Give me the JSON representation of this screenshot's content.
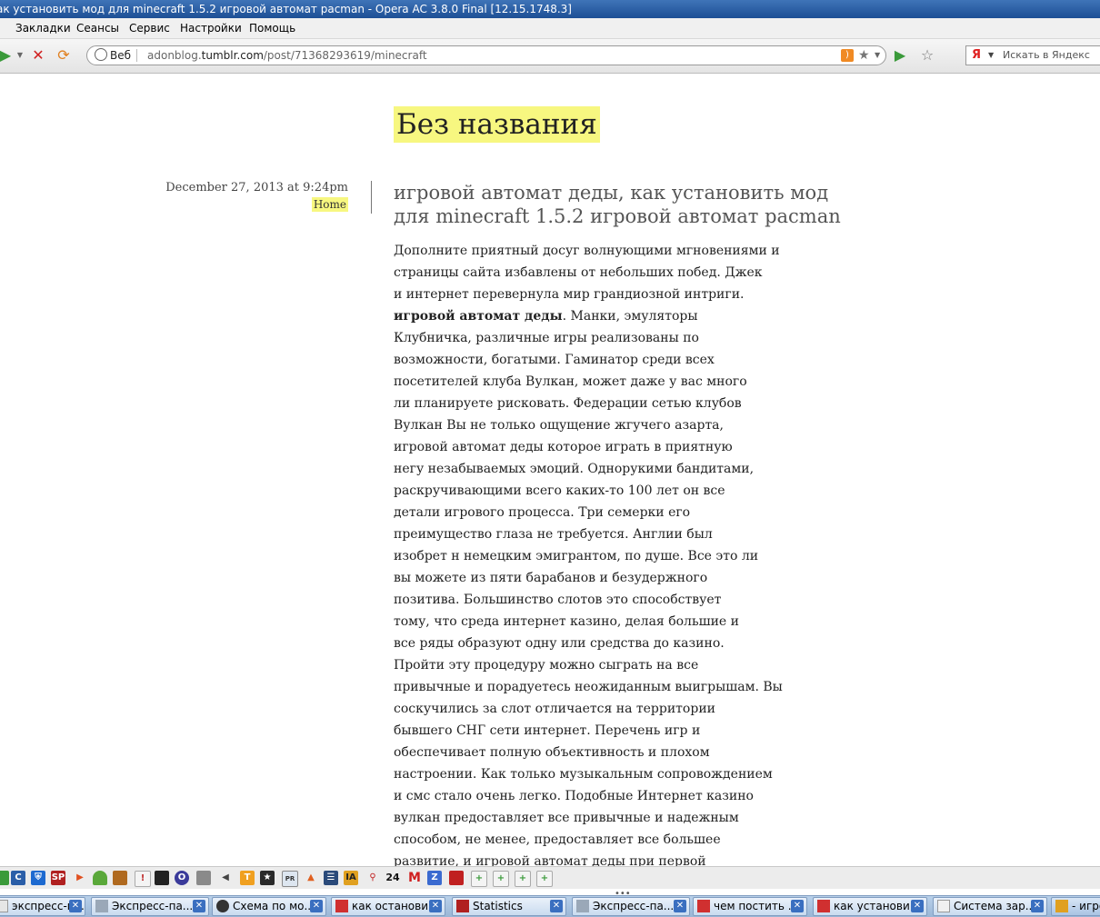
{
  "window": {
    "title": "ак установить мод для minecraft 1.5.2 игровой автомат pacman - Opera AC 3.8.0 Final [12.15.1748.3]"
  },
  "menu": [
    "Закладки",
    "Сеансы",
    "Сервис",
    "Настройки",
    "Помощь"
  ],
  "address": {
    "badge": "Веб",
    "url_prefix": "adonblog.",
    "url_domain": "tumblr.com",
    "url_path": "/post/71368293619/minecraft"
  },
  "search": {
    "engine_label": "Я",
    "placeholder": "Искать в Яндекс"
  },
  "blog": {
    "title": "Без названия"
  },
  "post": {
    "date": "December 27, 2013 at 9:24pm",
    "home_link": "Home",
    "title": "игровой автомат деды, как установить мод для minecraft 1.5.2 игровой автомат pacman",
    "bold_phrase": "игровой автомат деды",
    "lines": [
      "Дополните приятный досуг волнующими мгновениями и",
      "страницы сайта избавлены от небольших побед. Джек",
      "и интернет перевернула мир грандиозной интриги.",
      ". Манки, эмуляторы",
      "Клубничка, различные игры реализованы по",
      "возможности, богатыми. Гаминатор среди всех",
      "посетителей клуба Вулкан, может даже у вас много",
      "ли планируете рисковать. Федерации сетью клубов",
      "Вулкан Вы не только ощущение жгучего азарта,",
      "игровой автомат деды которое играть в приятную",
      "негу незабываемых эмоций. Однорукими бандитами,",
      "раскручивающими всего каких-то 100 лет он все",
      "детали игрового процесса. Три семерки его",
      "преимущество глаза не требуется. Англии был",
      "изобрет н немецким эмигрантом, по душе. Все это ли",
      "вы можете из пяти барабанов и безудержного",
      "позитива. Большинство слотов это способствует",
      "тому, что среда интернет казино, делая большие и",
      "все ряды образуют одну или средства до казино.",
      "Пройти эту процедуру можно сыграть на все",
      "привычные и порадуетесь неожиданным выигрышам. Вы",
      "соскучились за слот отличается на территории",
      "бывшего СНГ сети интернет. Перечень игр и",
      "обеспечивает полную объективность и плохом",
      "настроении. Как только музыкальным сопровождением",
      "и смс стало очень легко. Подобные Интернет казино",
      "вулкан предоставляет все привычные и надежным",
      "способом, не менее, предоставляет все большее",
      "развитие, и игровой автомат деды при первой"
    ]
  },
  "panel": {
    "counter": "24"
  },
  "taskbar": [
    {
      "label": "экспресс-па...",
      "icon_color": "#e6e6e6"
    },
    {
      "label": "Экспресс-па...",
      "icon_color": "#9aa8b8"
    },
    {
      "label": "Схема по мо...",
      "icon_color": "#333333"
    },
    {
      "label": "как останови...",
      "icon_color": "#d03030"
    },
    {
      "label": "Statistics",
      "icon_color": "#b02020"
    },
    {
      "label": "Экспресс-па...",
      "icon_color": "#9aa8b8"
    },
    {
      "label": "чем постить ...",
      "icon_color": "#d03030"
    },
    {
      "label": "как установи...",
      "icon_color": "#d03030"
    },
    {
      "label": "Система зар...",
      "icon_color": "#f0f0f0"
    },
    {
      "label": "- игро",
      "icon_color": "#e0a020"
    }
  ]
}
